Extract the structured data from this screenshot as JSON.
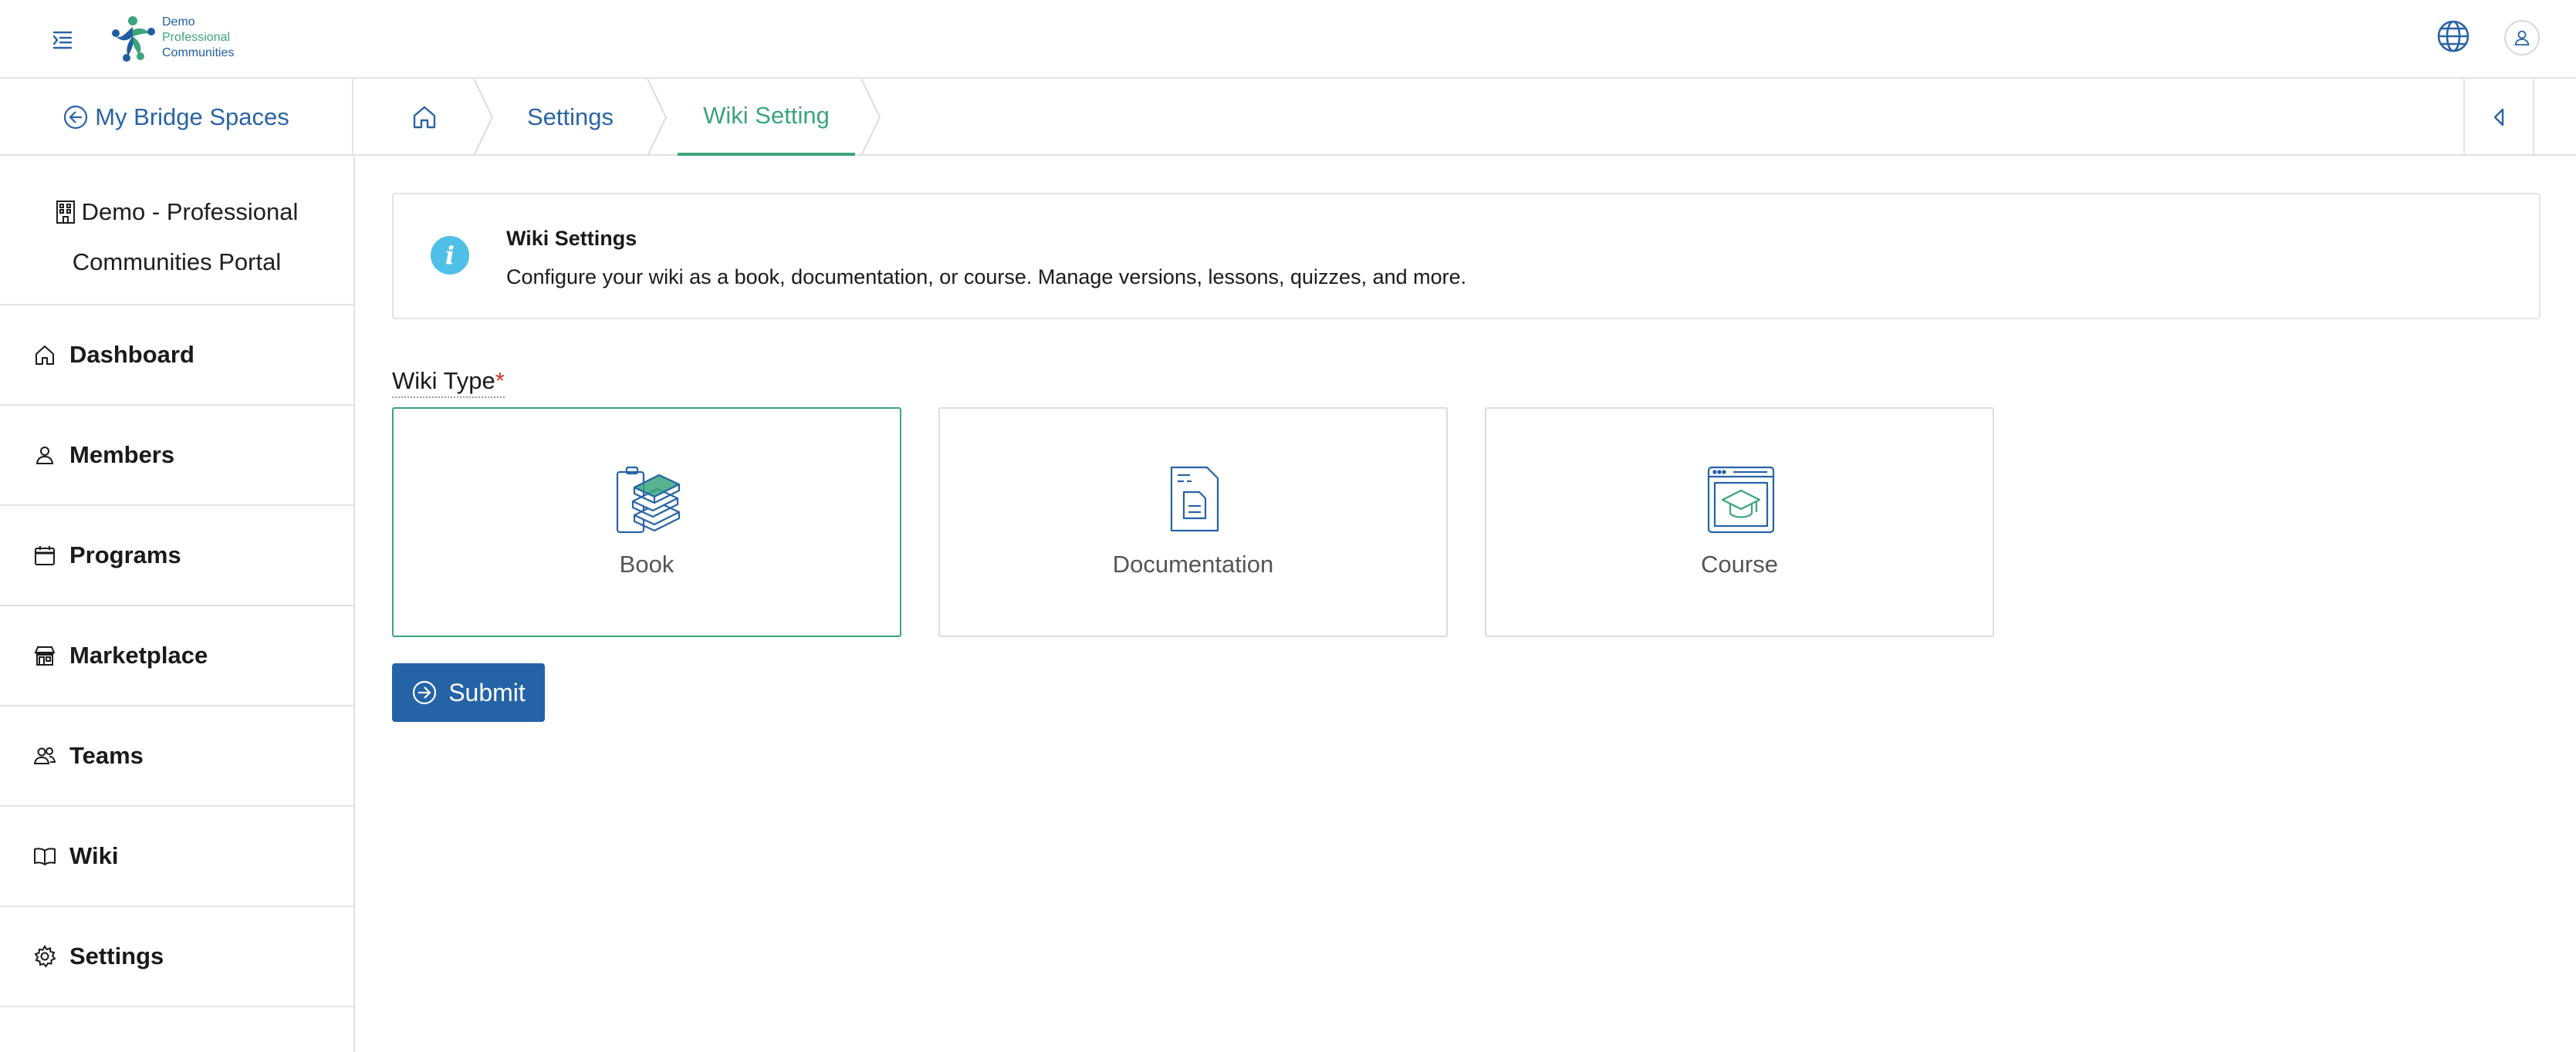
{
  "brand": {
    "logo_line1": "Demo",
    "logo_line2": "Professional",
    "logo_line3": "Communities",
    "primary_color": "#2563a7",
    "accent_color": "#3aa57a"
  },
  "header": {
    "menu_icon": "menu-indent-icon",
    "globe_icon": "globe-icon",
    "user_icon": "user-icon"
  },
  "breadcrumb": {
    "back_label": "My Bridge Spaces",
    "home_icon": "home-icon",
    "items": [
      {
        "label": "Settings"
      },
      {
        "label": "Wiki Setting"
      }
    ],
    "collapse_icon": "caret-left-icon"
  },
  "sidebar": {
    "portal_line1": "Demo - Professional",
    "portal_line2": "Communities Portal",
    "items": [
      {
        "label": "Dashboard",
        "icon": "home-icon"
      },
      {
        "label": "Members",
        "icon": "user-icon"
      },
      {
        "label": "Programs",
        "icon": "calendar-icon"
      },
      {
        "label": "Marketplace",
        "icon": "store-icon"
      },
      {
        "label": "Teams",
        "icon": "users-icon"
      },
      {
        "label": "Wiki",
        "icon": "book-open-icon"
      },
      {
        "label": "Settings",
        "icon": "gear-icon"
      }
    ]
  },
  "info": {
    "title": "Wiki Settings",
    "description": "Configure your wiki as a book, documentation, or course. Manage versions, lessons, quizzes, and more.",
    "icon": "info-icon"
  },
  "form": {
    "wiki_type_label": "Wiki Type",
    "required_mark": "*",
    "options": [
      {
        "label": "Book",
        "icon": "books-icon",
        "selected": true
      },
      {
        "label": "Documentation",
        "icon": "document-icon",
        "selected": false
      },
      {
        "label": "Course",
        "icon": "graduation-cap-icon",
        "selected": false
      }
    ],
    "submit_label": "Submit"
  }
}
